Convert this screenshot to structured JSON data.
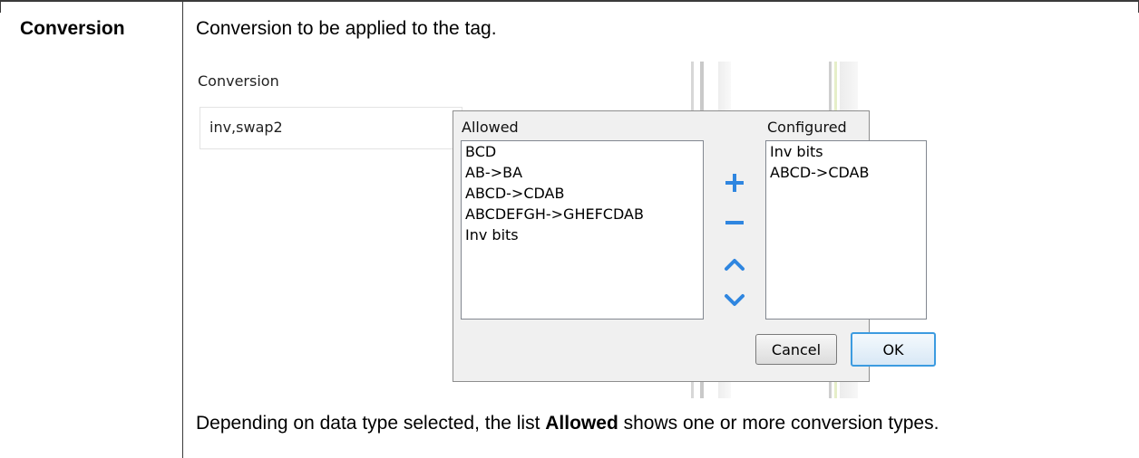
{
  "row": {
    "term": "Conversion",
    "description": "Conversion to be applied to the tag.",
    "footnote_before": "Depending on data type selected, the list ",
    "footnote_bold": "Allowed",
    "footnote_after": " shows one or more conversion types."
  },
  "screenshot": {
    "field_label": "Conversion",
    "field_value": "inv,swap2",
    "dialog": {
      "allowed_label": "Allowed",
      "configured_label": "Configured",
      "allowed_items": [
        "BCD",
        "AB->BA",
        "ABCD->CDAB",
        "ABCDEFGH->GHEFCDAB",
        "Inv bits"
      ],
      "configured_items": [
        "Inv bits",
        "ABCD->CDAB"
      ],
      "controls": [
        "plus-icon",
        "minus-icon",
        "chevron-up-icon",
        "chevron-down-icon"
      ],
      "cancel_label": "Cancel",
      "ok_label": "OK",
      "accent_color": "#2f86e0"
    }
  }
}
